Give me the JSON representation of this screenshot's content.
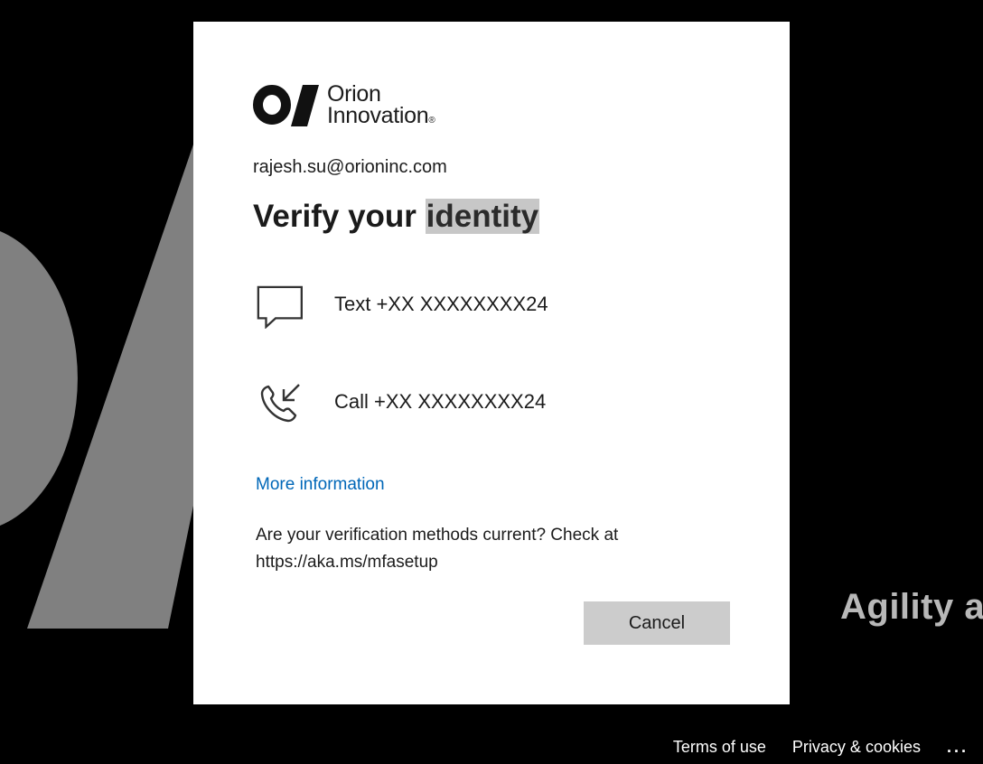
{
  "background": {
    "tagline": "Agility a",
    "color": "#000000",
    "art_color": "#808080"
  },
  "card": {
    "logo": {
      "name": "orion-innovation-logo",
      "line1": "Orion",
      "line2": "Innovation"
    },
    "account": "rajesh.su@orioninc.com",
    "title_prefix": "Verify your ",
    "title_highlight": "identity",
    "methods": [
      {
        "icon": "chat-bubble-icon",
        "label": "Text +XX XXXXXXXX24"
      },
      {
        "icon": "phone-call-icon",
        "label": "Call +XX XXXXXXXX24"
      }
    ],
    "more_info_link": "More information",
    "note_line1": "Are your verification methods current? Check at",
    "note_line2": "https://aka.ms/mfasetup",
    "cancel_label": "Cancel",
    "link_color": "#0067b8",
    "button_color": "#cccccc"
  },
  "footer": {
    "terms": "Terms of use",
    "privacy": "Privacy & cookies",
    "more": "..."
  }
}
